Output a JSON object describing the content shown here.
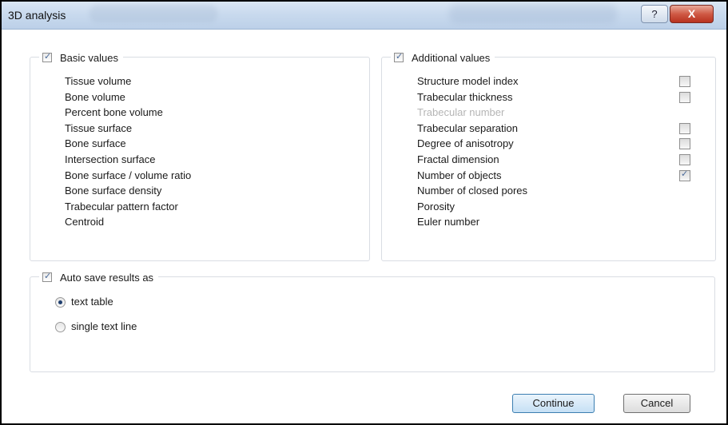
{
  "window": {
    "title": "3D analysis",
    "help_glyph": "?",
    "close_glyph": "X"
  },
  "basic": {
    "header": "Basic values",
    "checked": true,
    "items": [
      "Tissue volume",
      "Bone volume",
      "Percent bone volume",
      "Tissue surface",
      "Bone surface",
      "Intersection surface",
      "Bone surface / volume ratio",
      "Bone surface density",
      "Trabecular pattern factor",
      "Centroid"
    ]
  },
  "additional": {
    "header": "Additional values",
    "checked": true,
    "items": [
      {
        "label": "Structure model index",
        "checkbox": true,
        "checked": false,
        "disabled": false
      },
      {
        "label": "Trabecular thickness",
        "checkbox": true,
        "checked": false,
        "disabled": false
      },
      {
        "label": "Trabecular number",
        "checkbox": false,
        "checked": false,
        "disabled": true
      },
      {
        "label": "Trabecular separation",
        "checkbox": true,
        "checked": false,
        "disabled": false
      },
      {
        "label": "Degree of anisotropy",
        "checkbox": true,
        "checked": false,
        "disabled": false
      },
      {
        "label": "Fractal dimension",
        "checkbox": true,
        "checked": false,
        "disabled": false
      },
      {
        "label": "Number of objects",
        "checkbox": true,
        "checked": true,
        "disabled": false
      },
      {
        "label": "Number of closed pores",
        "checkbox": false,
        "checked": false,
        "disabled": false
      },
      {
        "label": "Porosity",
        "checkbox": false,
        "checked": false,
        "disabled": false
      },
      {
        "label": "Euler number",
        "checkbox": false,
        "checked": false,
        "disabled": false
      }
    ]
  },
  "autosave": {
    "header": "Auto save results as",
    "checked": true,
    "options": [
      {
        "label": "text table",
        "selected": true
      },
      {
        "label": "single text line",
        "selected": false
      }
    ]
  },
  "buttons": {
    "continue": "Continue",
    "cancel": "Cancel"
  }
}
